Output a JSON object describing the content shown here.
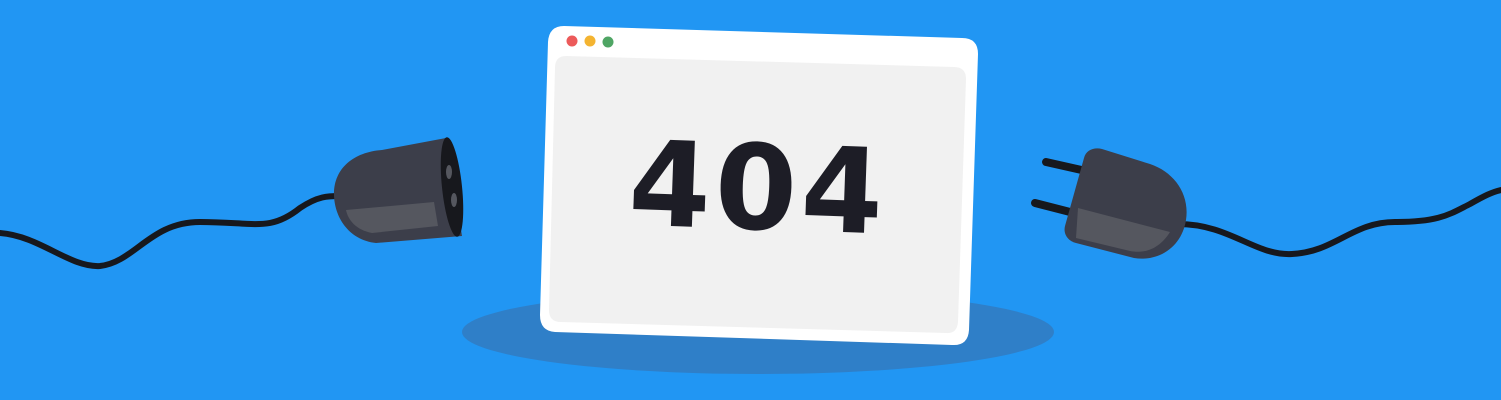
{
  "error": {
    "code": "404"
  },
  "colors": {
    "background": "#2196f3",
    "shadow": "#2f7fc8",
    "cable": "#17181d",
    "plug_body": "#3c3e4a",
    "plug_highlight": "#55575f",
    "window_frame": "#ffffff",
    "window_content": "#f1f1f1",
    "code_text": "#1d1d26",
    "dot_red": "#ec5a5a",
    "dot_yellow": "#f4b431",
    "dot_green": "#4fa564"
  },
  "icons": {
    "window_controls": [
      "close-dot-icon",
      "minimize-dot-icon",
      "maximize-dot-icon"
    ],
    "left_connector": "socket-plug-icon",
    "right_connector": "electric-plug-icon"
  }
}
